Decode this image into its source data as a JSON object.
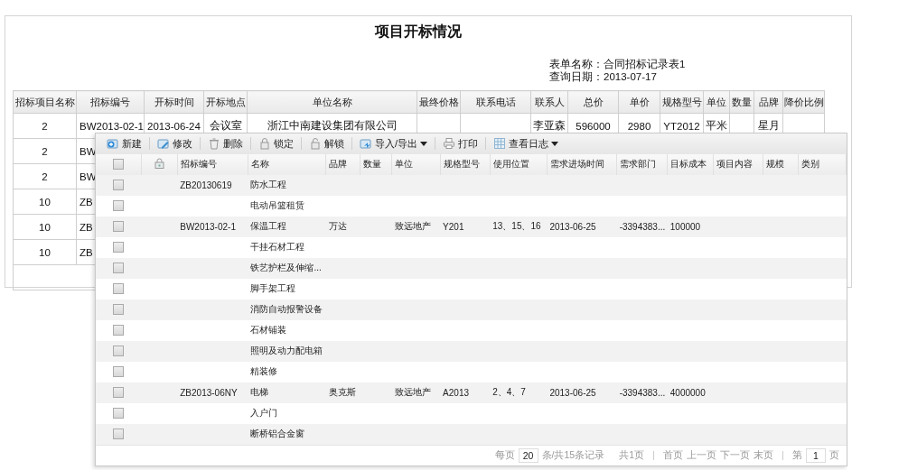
{
  "report": {
    "title": "项目开标情况",
    "meta": [
      "表单名称：合同招标记录表1",
      "查询日期：2013-07-17"
    ],
    "columns": [
      "招标项目名称",
      "招标编号",
      "开标时间",
      "开标地点",
      "单位名称",
      "最终价格",
      "联系电话",
      "联系人",
      "总价",
      "单价",
      "规格型号",
      "单位",
      "数量",
      "品牌",
      "降价比例"
    ],
    "rows": [
      [
        "2",
        "BW2013-02-1",
        "2013-06-24",
        "会议室",
        "浙江中南建设集团有限公司",
        null,
        null,
        "李亚森",
        "596000",
        "2980",
        "YT2012",
        "平米",
        null,
        "星月",
        null
      ],
      [
        "2",
        "BW"
      ],
      [
        "2",
        "BW"
      ],
      [
        "10",
        "ZB"
      ],
      [
        "10",
        "ZB"
      ],
      [
        "10",
        "ZB"
      ]
    ]
  },
  "grid": {
    "toolbar": [
      {
        "label": "新建",
        "kind": "new",
        "has_menu": false
      },
      {
        "label": "修改",
        "kind": "edit",
        "has_menu": false
      },
      {
        "label": "删除",
        "kind": "delete",
        "has_menu": false
      },
      {
        "label": "锁定",
        "kind": "lock",
        "has_menu": false
      },
      {
        "label": "解锁",
        "kind": "unlock",
        "has_menu": false
      },
      {
        "label": "导入/导出",
        "kind": "transfer",
        "has_menu": true
      },
      {
        "label": "打印",
        "kind": "print",
        "has_menu": false
      },
      {
        "label": "查看日志",
        "kind": "log",
        "has_menu": true
      }
    ],
    "select_all": {
      "checked": false
    },
    "columns": [
      "招标编号",
      "名称",
      "品牌",
      "数量",
      "单位",
      "规格型号",
      "使用位置",
      "需求进场时间",
      "需求部门",
      "目标成本",
      "项目内容",
      "规模",
      "类别"
    ],
    "rows": [
      {
        "checked": false,
        "cells": [
          "ZB20130619",
          "防水工程"
        ]
      },
      {
        "checked": false,
        "cells": [
          null,
          "电动吊篮租赁"
        ]
      },
      {
        "checked": false,
        "cells": [
          "BW2013-02-1",
          "保温工程",
          "万达",
          null,
          "致远地产",
          "Y201",
          "13、15、16",
          "2013-06-25",
          "-3394383...",
          "100000"
        ]
      },
      {
        "checked": false,
        "cells": [
          null,
          "干挂石材工程"
        ]
      },
      {
        "checked": false,
        "cells": [
          null,
          "铁艺护栏及伸缩..."
        ]
      },
      {
        "checked": false,
        "cells": [
          null,
          "脚手架工程"
        ]
      },
      {
        "checked": false,
        "cells": [
          null,
          "消防自动报警设备"
        ]
      },
      {
        "checked": false,
        "cells": [
          null,
          "石材铺装"
        ]
      },
      {
        "checked": false,
        "cells": [
          null,
          "照明及动力配电箱"
        ]
      },
      {
        "checked": false,
        "cells": [
          null,
          "精装修"
        ]
      },
      {
        "checked": false,
        "cells": [
          "ZB2013-06NY",
          "电梯",
          "奥克斯",
          null,
          "致远地产",
          "A2013",
          "2、4、7",
          "2013-06-25",
          "-3394383...",
          "4000000"
        ]
      },
      {
        "checked": false,
        "cells": [
          null,
          "入户门"
        ]
      },
      {
        "checked": false,
        "cells": [
          null,
          "断桥铝合金窗"
        ]
      }
    ],
    "pager": {
      "per_page_label": "每页",
      "page_size": "20",
      "records": "条/共15条记录",
      "pages": "共1页",
      "links": [
        "首页",
        "上一页",
        "下一页",
        "末页"
      ],
      "page_prefix": "第",
      "page": "1",
      "page_suffix": "页"
    }
  }
}
